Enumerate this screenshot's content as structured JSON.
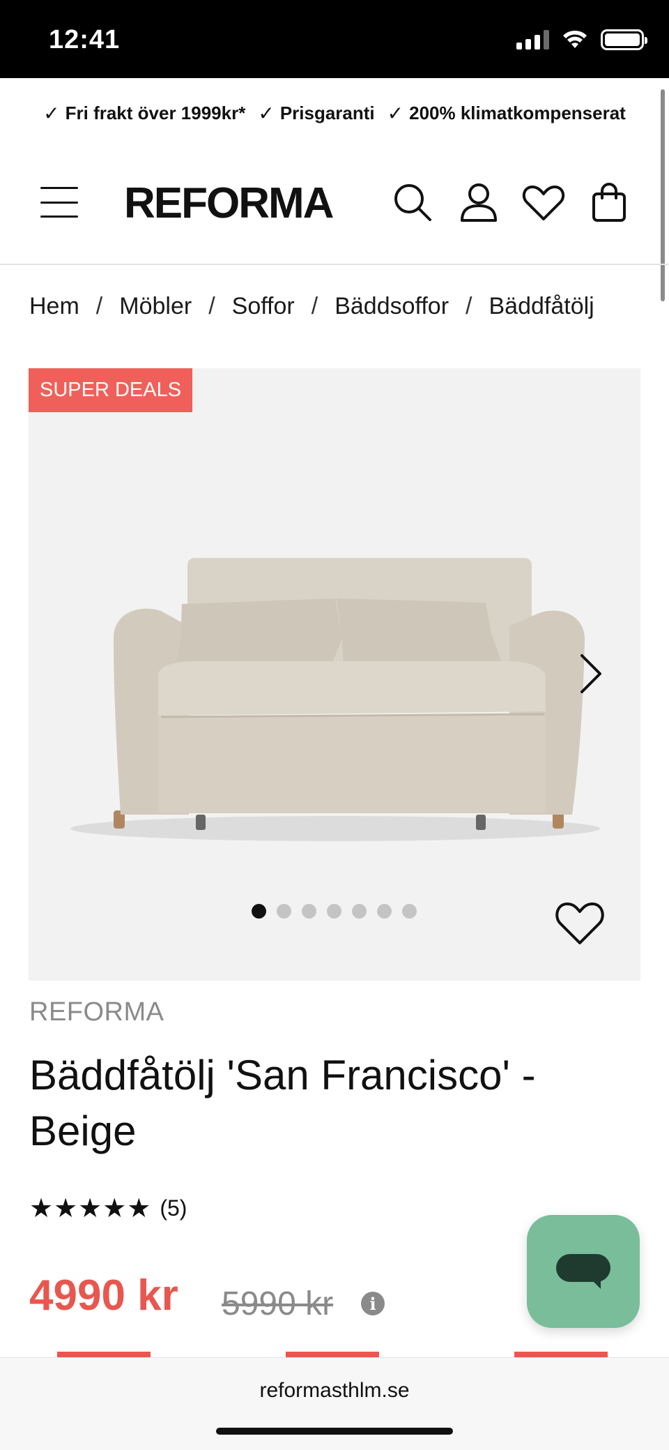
{
  "status_bar": {
    "time": "12:41",
    "icons": [
      "signal-icon",
      "wifi-icon",
      "battery-icon"
    ]
  },
  "usp_bar": {
    "items": [
      "Fri frakt över 1999kr*",
      "Prisgaranti",
      "200% klimatkompenserat"
    ]
  },
  "header": {
    "logo": "REFORMA",
    "icons": [
      "menu-icon",
      "search-icon",
      "account-icon",
      "wishlist-icon",
      "cart-icon"
    ]
  },
  "breadcrumb": {
    "items": [
      "Hem",
      "Möbler",
      "Soffor",
      "Bäddsoffor",
      "Bäddfåtölj"
    ],
    "separator": "/"
  },
  "gallery": {
    "badge": "SUPER DEALS",
    "image_count": 7,
    "active_index": 0
  },
  "product": {
    "brand": "REFORMA",
    "title": "Bäddfåtölj 'San Francisco' - Beige",
    "stars": "★★★★★",
    "rating_value": 5,
    "review_count": "(5)",
    "price": "4990 kr",
    "old_price": "5990 kr",
    "info_icon": "i"
  },
  "colors": {
    "accent_red": "#e8574f",
    "badge_red": "#f0605a",
    "chat_green": "#79bd9b",
    "muted_gray": "#8a8a8a"
  },
  "browser": {
    "url": "reformasthlm.se"
  }
}
